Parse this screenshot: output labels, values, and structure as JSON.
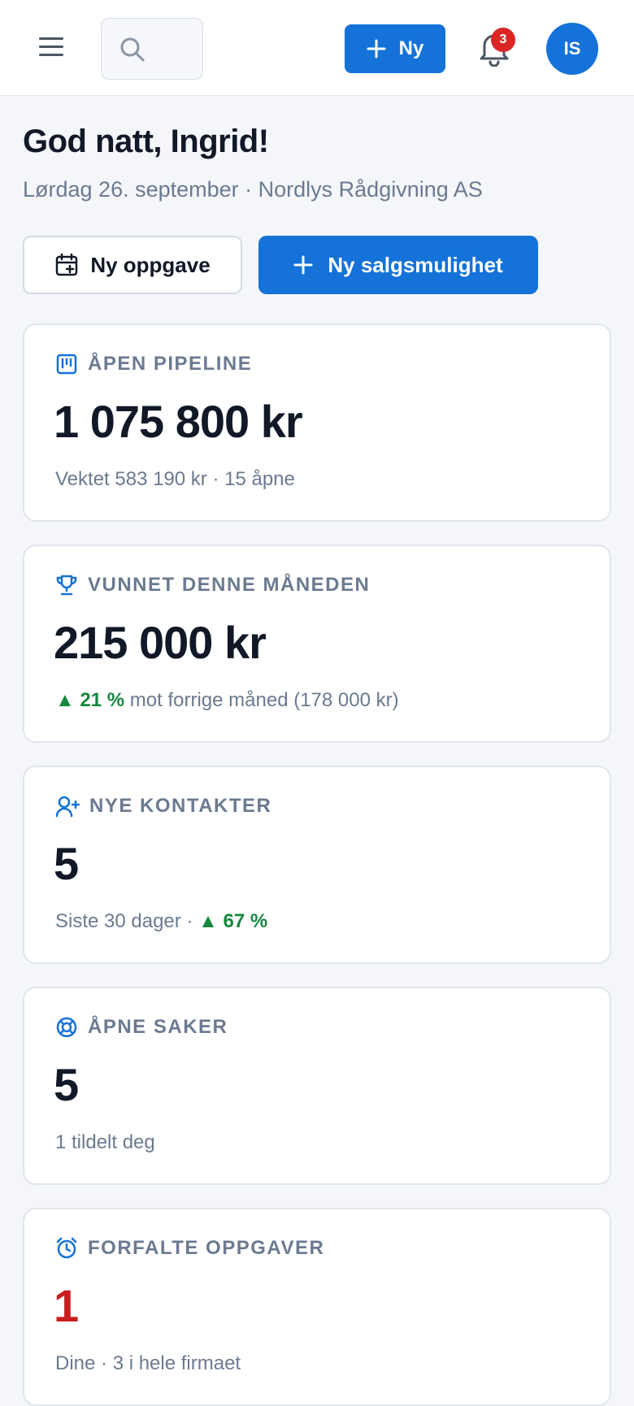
{
  "header": {
    "new_label": "Ny",
    "notification_count": "3",
    "avatar_initials": "IS"
  },
  "greeting": "God natt, Ingrid!",
  "subtitle": "Lørdag 26. september · Nordlys Rådgivning AS",
  "actions": {
    "new_task": "Ny oppgave",
    "new_opportunity": "Ny salgsmulighet"
  },
  "cards": [
    {
      "icon": "kanban-icon",
      "label": "ÅPEN PIPELINE",
      "value": "1 075 800 kr",
      "sub": "Vektet 583 190 kr · 15 åpne"
    },
    {
      "icon": "trophy-icon",
      "label": "VUNNET DENNE MÅNEDEN",
      "value": "215 000 kr",
      "trend": "▲ 21 %",
      "sub": "mot forrige måned (178 000 kr)"
    },
    {
      "icon": "user-plus-icon",
      "label": "NYE KONTAKTER",
      "value": "5",
      "sub": "Siste 30 dager ·",
      "trend": "▲ 67 %"
    },
    {
      "icon": "lifebuoy-icon",
      "label": "ÅPNE SAKER",
      "value": "5",
      "sub": "1 tildelt deg"
    },
    {
      "icon": "alarm-clock-icon",
      "label": "FORFALTE OPPGAVER",
      "value": "1",
      "sub": "Dine · 3 i hele firmaet"
    }
  ],
  "colors": {
    "accent": "#1472d8",
    "danger": "#c81e1e",
    "positive": "#15883e",
    "muted": "#6b7a90"
  }
}
